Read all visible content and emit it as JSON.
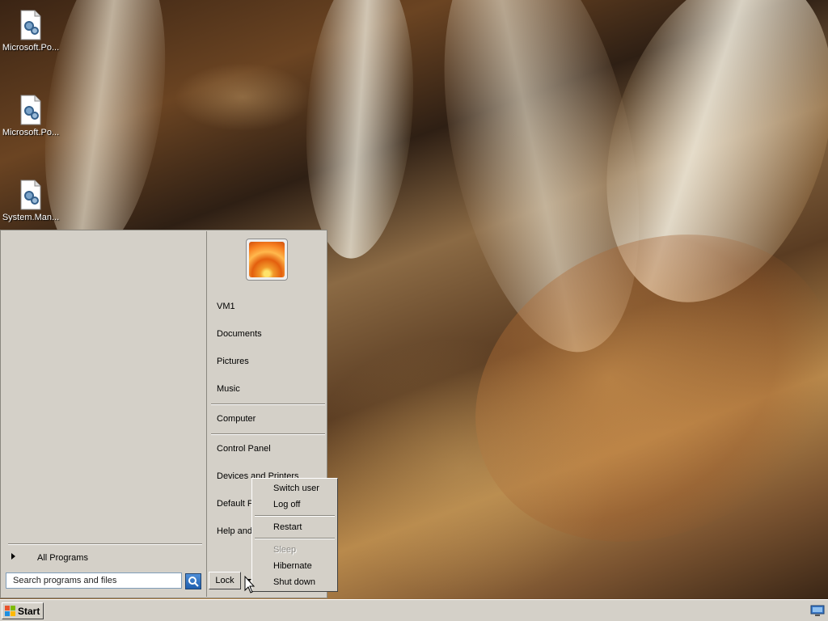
{
  "desktop": {
    "icons": [
      {
        "label": "Microsoft.Po...",
        "icon": "settings-file-icon"
      },
      {
        "label": "Microsoft.Po...",
        "icon": "settings-file-icon"
      },
      {
        "label": "System.Man...",
        "icon": "settings-file-icon"
      }
    ]
  },
  "start_menu": {
    "all_programs": "All Programs",
    "search_placeholder": "Search programs and files",
    "user_picture": "flower-avatar",
    "right_items": [
      "VM1",
      "Documents",
      "Pictures",
      "Music",
      "Computer",
      "Control Panel",
      "Devices and Printers",
      "Default Programs",
      "Help and Support"
    ],
    "right_items_visible": [
      "VM1",
      "Documents",
      "Pictures",
      "Music",
      "Computer",
      "Control Panel",
      "Devices and Printers",
      "Default P",
      "Help and"
    ],
    "lock_label": "Lock"
  },
  "shutdown_menu": {
    "items": [
      {
        "label": "Switch user",
        "enabled": true
      },
      {
        "label": "Log off",
        "enabled": true
      },
      {
        "label": "Restart",
        "enabled": true
      },
      {
        "label": "Sleep",
        "enabled": false
      },
      {
        "label": "Hibernate",
        "enabled": true
      },
      {
        "label": "Shut down",
        "enabled": true
      }
    ]
  },
  "taskbar": {
    "start_label": "Start",
    "tray_icon": "monitor-icon"
  }
}
